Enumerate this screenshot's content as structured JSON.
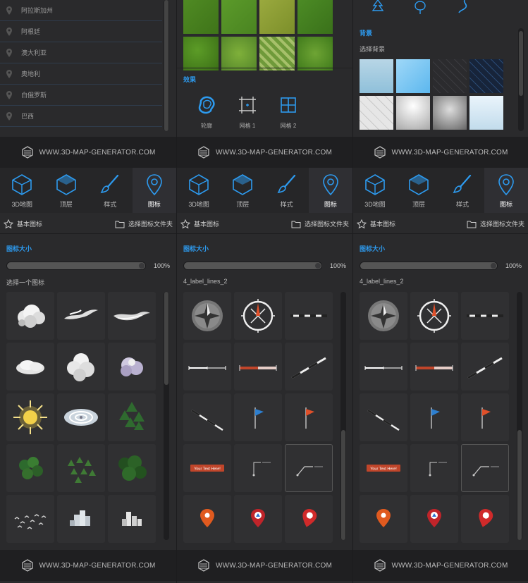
{
  "brand_text": "WWW.3D-MAP-GENERATOR.COM",
  "accent_color": "#2d9bf0",
  "countries": [
    "阿拉斯加州",
    "阿根廷",
    "澳大利亚",
    "奥地利",
    "白俄罗斯",
    "巴西"
  ],
  "effects": {
    "title": "效果",
    "items": [
      {
        "label": "轮廓",
        "icon": "outline-icon"
      },
      {
        "label": "网格 1",
        "icon": "grid-1-icon"
      },
      {
        "label": "网格 2",
        "icon": "grid-2-icon"
      }
    ]
  },
  "background": {
    "title": "背景",
    "select_label": "选择背景"
  },
  "tabs": [
    {
      "label": "3D地图",
      "icon": "cube-3d-icon"
    },
    {
      "label": "顶层",
      "icon": "top-layer-icon"
    },
    {
      "label": "样式",
      "icon": "brush-icon"
    },
    {
      "label": "图标",
      "icon": "map-pin-icon",
      "active": true
    }
  ],
  "subbar": {
    "basic_icons": "基本图标",
    "select_folder": "选择图标文件夹"
  },
  "icon_size": {
    "title": "图标大小",
    "value": "100%",
    "fraction": 1.0
  },
  "panels": [
    {
      "grid_title": "选择一个图标",
      "set": "clouds"
    },
    {
      "grid_title": "4_label_lines_2",
      "set": "labels"
    },
    {
      "grid_title": "4_label_lines_2",
      "set": "labels"
    }
  ],
  "cell_labels": {
    "badge": "Your Text Here!"
  }
}
